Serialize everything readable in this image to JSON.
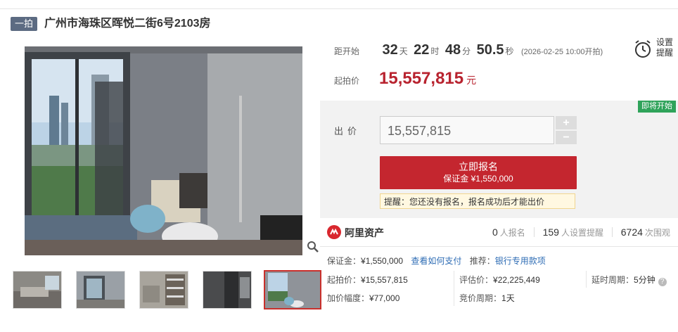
{
  "header": {
    "badge": "一拍",
    "title": "广州市海珠区晖悦二街6号2103房"
  },
  "countdown": {
    "label": "距开始",
    "days": "32",
    "days_unit": "天",
    "hours": "22",
    "hours_unit": "时",
    "minutes": "48",
    "minutes_unit": "分",
    "seconds": "50.5",
    "seconds_unit": "秒",
    "start_note": "(2026-02-25 10:00开拍)"
  },
  "reminder": {
    "label_line1": "设置",
    "label_line2": "提醒",
    "icon": "alarm-clock-icon"
  },
  "start_price": {
    "label": "起拍价",
    "value": "15,557,815",
    "unit": "元"
  },
  "bid": {
    "status_badge": "即将开始",
    "label": "出价",
    "value": "15,557,815",
    "plus": "+",
    "minus": "−",
    "signup_main": "立即报名",
    "signup_sub": "保证金 ¥1,550,000",
    "notice": "提醒：您还没有报名，报名成功后才能出价"
  },
  "organizer": {
    "name": "阿里资产",
    "logo_icon": "ali-assets-logo-icon"
  },
  "stats": {
    "signups": "0",
    "signups_unit": "人报名",
    "reminders": "159",
    "reminders_unit": "人设置提醒",
    "views": "6724",
    "views_unit": "次围观"
  },
  "details": {
    "deposit_label": "保证金：",
    "deposit_value": "¥1,550,000",
    "how_to_pay": "查看如何支付",
    "recommend_label": "推荐：",
    "recommend_link": "银行专用款项",
    "start_price_label": "起拍价：",
    "start_price_value": "¥15,557,815",
    "appraisal_label": "评估价：",
    "appraisal_value": "¥22,225,449",
    "delay_label": "延时周期：",
    "delay_value": "5分钟",
    "increment_label": "加价幅度：",
    "increment_value": "¥77,000",
    "cycle_label": "竞价周期：",
    "cycle_value": "1天"
  },
  "gallery": {
    "thumbnails": [
      "living-room",
      "bedroom-window",
      "study-shelves",
      "dark-room",
      "kids-room"
    ],
    "active_index": 4,
    "zoom_icon": "magnifier-icon"
  },
  "colors": {
    "accent_red": "#c4262f",
    "price_red": "#b8232f",
    "badge_slate": "#5c6b82",
    "status_green": "#2fa35a",
    "link_blue": "#2f6db5"
  }
}
